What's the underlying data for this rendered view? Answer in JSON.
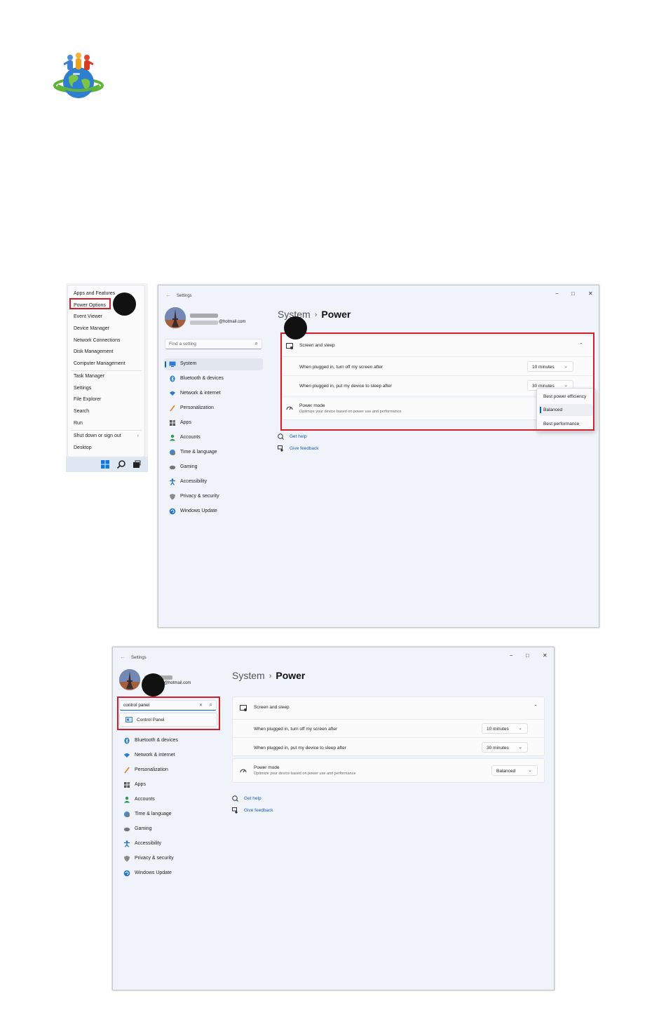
{
  "context_menu": {
    "items": [
      {
        "label": "Apps and Features"
      },
      {
        "label": "Power Options"
      },
      {
        "label": "Event Viewer"
      },
      {
        "label": "Device Manager"
      },
      {
        "label": "Network Connections"
      },
      {
        "label": "Disk Management"
      },
      {
        "label": "Computer Management"
      },
      {
        "label": "Task Manager"
      },
      {
        "label": "Settings"
      },
      {
        "label": "File Explorer"
      },
      {
        "label": "Search"
      },
      {
        "label": "Run"
      },
      {
        "label": "Shut down or sign out"
      },
      {
        "label": "Desktop"
      }
    ],
    "submenu_glyph": "›",
    "taskbar_icons": [
      "windows-start-icon",
      "search-icon",
      "task-view-icon"
    ]
  },
  "window1": {
    "title": "Settings",
    "back_glyph": "←",
    "controls": {
      "minimize": "−",
      "maximize": "□",
      "close": "✕"
    },
    "account_email": "@hotmail.com",
    "search_placeholder": "Find a setting",
    "nav": [
      {
        "label": "System",
        "icon": "system-icon",
        "active": true
      },
      {
        "label": "Bluetooth & devices",
        "icon": "bluetooth-icon"
      },
      {
        "label": "Network & internet",
        "icon": "wifi-icon"
      },
      {
        "label": "Personalization",
        "icon": "brush-icon"
      },
      {
        "label": "Apps",
        "icon": "apps-icon"
      },
      {
        "label": "Accounts",
        "icon": "person-icon"
      },
      {
        "label": "Time & language",
        "icon": "globe-clock-icon"
      },
      {
        "label": "Gaming",
        "icon": "gamepad-icon"
      },
      {
        "label": "Accessibility",
        "icon": "accessibility-icon"
      },
      {
        "label": "Privacy & security",
        "icon": "shield-icon"
      },
      {
        "label": "Windows Update",
        "icon": "update-icon"
      }
    ],
    "breadcrumb": {
      "parent": "System",
      "separator": "›",
      "current": "Power"
    },
    "screen_sleep": {
      "title": "Screen and sleep",
      "rows": [
        {
          "label": "When plugged in, turn off my screen after",
          "value": "10 minutes"
        },
        {
          "label": "When plugged in, put my device to sleep after",
          "value": "30 minutes"
        }
      ]
    },
    "power_mode": {
      "title": "Power mode",
      "description": "Optimize your device based on power use and performance",
      "options": [
        "Best power efficiency",
        "Balanced",
        "Best performance"
      ],
      "selected": "Balanced"
    },
    "links": {
      "help": "Get help",
      "feedback": "Give feedback"
    }
  },
  "window2": {
    "title": "Settings",
    "back_glyph": "←",
    "controls": {
      "minimize": "−",
      "maximize": "□",
      "close": "✕"
    },
    "account_email": "@hotmail.com",
    "search_value": "control panel",
    "search_clear": "✕",
    "suggestion": "Control Panel",
    "nav": [
      {
        "label": "Bluetooth & devices",
        "icon": "bluetooth-icon"
      },
      {
        "label": "Network & internet",
        "icon": "wifi-icon"
      },
      {
        "label": "Personalization",
        "icon": "brush-icon"
      },
      {
        "label": "Apps",
        "icon": "apps-icon"
      },
      {
        "label": "Accounts",
        "icon": "person-icon"
      },
      {
        "label": "Time & language",
        "icon": "globe-clock-icon"
      },
      {
        "label": "Gaming",
        "icon": "gamepad-icon"
      },
      {
        "label": "Accessibility",
        "icon": "accessibility-icon"
      },
      {
        "label": "Privacy & security",
        "icon": "shield-icon"
      },
      {
        "label": "Windows Update",
        "icon": "update-icon"
      }
    ],
    "breadcrumb": {
      "parent": "System",
      "separator": "›",
      "current": "Power"
    },
    "screen_sleep": {
      "title": "Screen and sleep",
      "rows": [
        {
          "label": "When plugged in, turn off my screen after",
          "value": "10 minutes"
        },
        {
          "label": "When plugged in, put my device to sleep after",
          "value": "30 minutes"
        }
      ]
    },
    "power_mode": {
      "title": "Power mode",
      "description": "Optimize your device based on power use and performance",
      "value": "Balanced"
    },
    "links": {
      "help": "Get help",
      "feedback": "Give feedback"
    }
  },
  "colors": {
    "highlight_box": "#d11f2b",
    "accent": "#0b64c0",
    "link": "#1a5fb4"
  }
}
